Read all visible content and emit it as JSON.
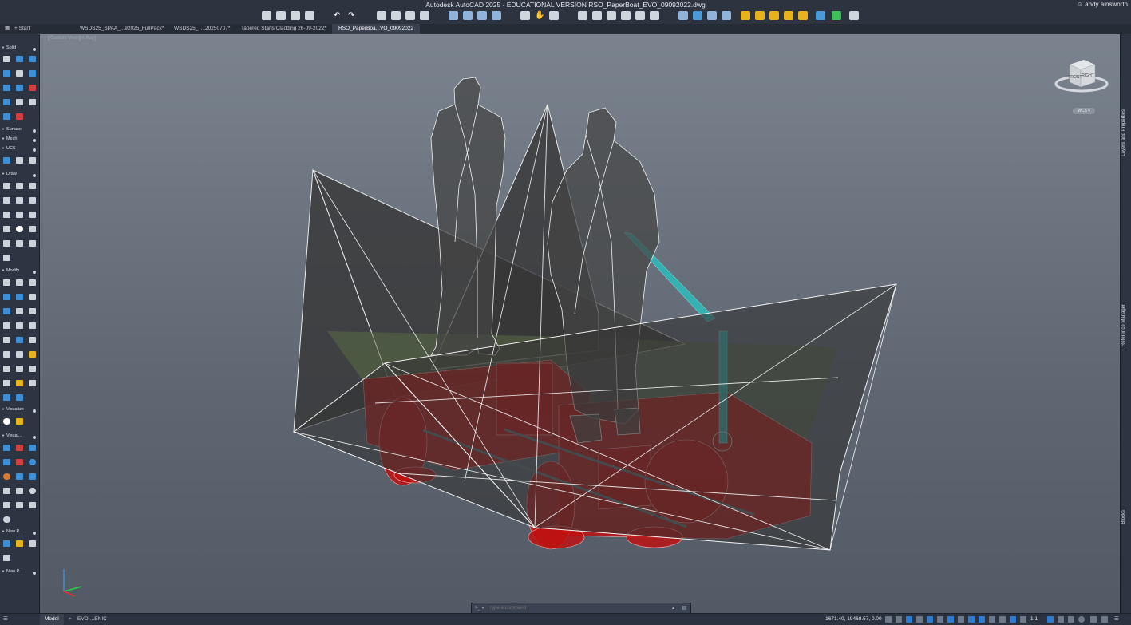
{
  "app": {
    "title": "Autodesk AutoCAD 2025 - EDUCATIONAL VERSION   RSO_PaperBoat_EVO_09092022.dwg",
    "user": "andy ainsworth"
  },
  "tabs": {
    "start": "Start",
    "items": [
      {
        "label": "WSDS25_SPAA_...92025_FullPack*"
      },
      {
        "label": "WSDS25_T...20250707*"
      },
      {
        "label": "Tapered Staris Cladding 26-09-2022*"
      },
      {
        "label": "RSO_PaperBoa...VO_09092022"
      }
    ]
  },
  "palette": {
    "sections": [
      {
        "label": "Solid"
      },
      {
        "label": "Surface"
      },
      {
        "label": "Mesh"
      },
      {
        "label": "UCS"
      },
      {
        "label": "Draw"
      },
      {
        "label": "Modify"
      },
      {
        "label": "Visualize"
      },
      {
        "label": "Visual..."
      },
      {
        "label": "New P..."
      },
      {
        "label": "New P..."
      }
    ]
  },
  "viewport": {
    "label": "[-][Custom View][X-Ray]",
    "viewcube": {
      "front": "FRONT",
      "right": "RIGHT",
      "wcs": "WCS"
    }
  },
  "right_panels": {
    "layers": "Layers and Properties",
    "refs": "Reference Manager",
    "blocks": "Blocks"
  },
  "command": {
    "prompt": ">_ ▾",
    "placeholder": "Type a command"
  },
  "status": {
    "model_tab": "Model",
    "layout_tab": "EVO-...ENIC",
    "coords": "-1671.40, 19468.57, 0.00",
    "scale": "1:1"
  },
  "colors": {
    "accent": "#2e7bd0",
    "hull": "#3a3a3a",
    "red_solids": "#c01010",
    "cyan_pole": "#2fb8b8",
    "wire": "#f2f2f2"
  }
}
